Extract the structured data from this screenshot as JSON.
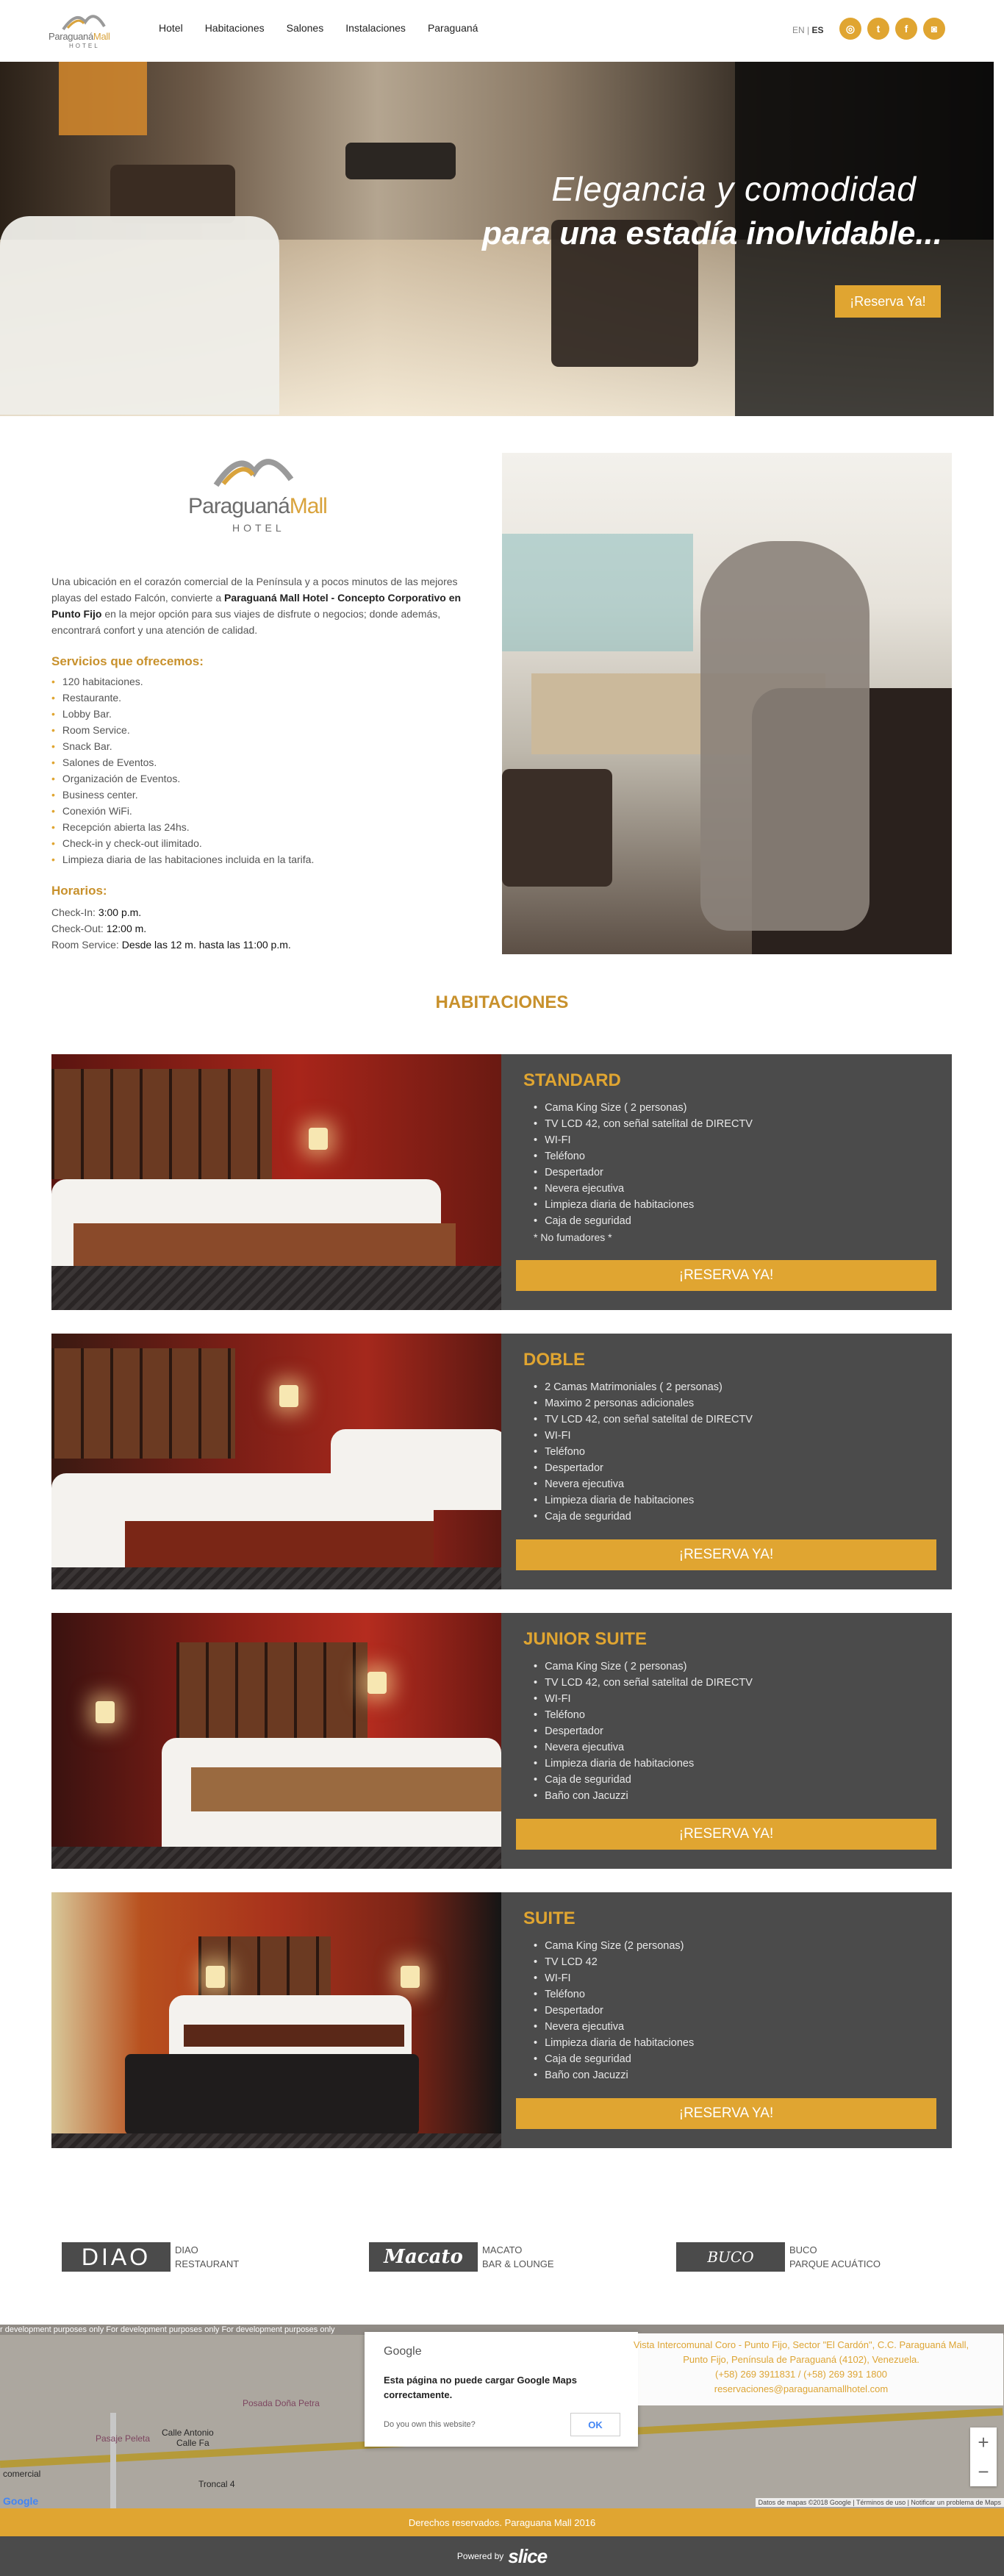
{
  "header": {
    "logo_text_a": "Paraguaná",
    "logo_text_b": "Mall",
    "logo_sub": "HOTEL",
    "nav": [
      "Hotel",
      "Habitaciones",
      "Salones",
      "Instalaciones",
      "Paraguaná"
    ],
    "lang_en": "EN",
    "lang_sep": "|",
    "lang_es": "ES",
    "socials": [
      {
        "icon": "tripadvisor-icon",
        "glyph": "◎"
      },
      {
        "icon": "twitter-icon",
        "glyph": "t"
      },
      {
        "icon": "facebook-icon",
        "glyph": "f"
      },
      {
        "icon": "instagram-icon",
        "glyph": "◙"
      }
    ]
  },
  "hero": {
    "line1": "Elegancia y comodidad",
    "line2": "para una estadía inolvidable...",
    "button": "¡Reserva Ya!"
  },
  "about": {
    "logo_name_a": "Paraguaná",
    "logo_name_b": "Mall",
    "logo_hotel": "HOTEL",
    "intro_1": "Una ubicación en el corazón comercial de la Península y a pocos minutos de las mejores playas del estado Falcón, convierte a ",
    "intro_bold": "Paraguaná Mall Hotel - Concepto Corporativo en Punto Fijo",
    "intro_2": " en la mejor opción para sus viajes de disfrute o negocios; donde además, encontrará confort y una atención de calidad.",
    "services_title": "Servicios que ofrecemos:",
    "services": [
      "120 habitaciones.",
      "Restaurante.",
      "Lobby Bar.",
      "Room Service.",
      "Snack Bar.",
      "Salones de Eventos.",
      "Organización de Eventos.",
      "Business center.",
      "Conexión WiFi.",
      "Recepción abierta las 24hs.",
      "Check-in y check-out ilimitado.",
      "Limpieza diaria de las habitaciones incluida en la tarifa."
    ],
    "hours_title": "Horarios:",
    "hours": [
      {
        "label": "Check-In: ",
        "value": "3:00 p.m."
      },
      {
        "label": "Check-Out: ",
        "value": "12:00 m."
      },
      {
        "label": "Room Service: ",
        "value": "Desde las 12 m. hasta las 11:00 p.m."
      }
    ]
  },
  "rooms_title": "HABITACIONES",
  "rooms": [
    {
      "title": "STANDARD",
      "features": [
        "Cama King Size ( 2 personas)",
        "TV LCD 42, con señal satelital de DIRECTV",
        "WI-FI",
        "Teléfono",
        "Despertador",
        "Nevera ejecutiva",
        "Limpieza diaria de habitaciones",
        "Caja de seguridad"
      ],
      "note": "* No fumadores *",
      "button": "¡RESERVA YA!"
    },
    {
      "title": "DOBLE",
      "features": [
        "2 Camas Matrimoniales ( 2 personas)",
        "Maximo 2 personas adicionales",
        "TV LCD 42, con señal satelital de DIRECTV",
        "WI-FI",
        "Teléfono",
        "Despertador",
        "Nevera ejecutiva",
        "Limpieza diaria de habitaciones",
        "Caja de seguridad"
      ],
      "note": "",
      "button": "¡RESERVA YA!"
    },
    {
      "title": "JUNIOR SUITE",
      "features": [
        "Cama King Size ( 2 personas)",
        "TV LCD 42, con señal satelital de DIRECTV",
        "WI-FI",
        "Teléfono",
        "Despertador",
        "Nevera ejecutiva",
        "Limpieza diaria de habitaciones",
        "Caja de seguridad",
        "Baño con Jacuzzi"
      ],
      "note": "",
      "button": "¡RESERVA YA!"
    },
    {
      "title": "SUITE",
      "features": [
        "Cama King Size (2 personas)",
        "TV LCD 42",
        "WI-FI",
        "Teléfono",
        "Despertador",
        "Nevera ejecutiva",
        "Limpieza diaria de habitaciones",
        "Caja de seguridad",
        "Baño con Jacuzzi"
      ],
      "note": "",
      "button": "¡RESERVA YA!"
    }
  ],
  "partners": [
    {
      "logo": "DIAO",
      "line1": "DIAO",
      "line2": "RESTAURANT"
    },
    {
      "logo": "Macato",
      "line1": "MACATO",
      "line2": "BAR & LOUNGE"
    },
    {
      "logo": "BUCO",
      "line1": "BUCO",
      "line2": "PARQUE ACUÁTICO"
    }
  ],
  "map": {
    "dev_text": "r development purposes only      For development purposes only      For development purposes only",
    "label_posada": "Posada Doña Petra",
    "label_calle": "Calle Antonio",
    "label_calle2": "Calle Fa",
    "label_pasaje": "Pasaje Peleta",
    "label_comercial": "comercial",
    "label_troncal": "Troncal 4",
    "modal_google": "Google",
    "modal_msg": "Esta página no puede cargar Google Maps correctamente.",
    "modal_own": "Do you own this website?",
    "modal_ok": "OK",
    "address_1": "Vista Intercomunal Coro - Punto Fijo, Sector \"El Cardón\", C.C. Paraguaná Mall,",
    "address_2": "Punto Fijo, Península de Paraguaná (4102), Venezuela.",
    "phones": "(+58) 269 3911831 / (+58) 269 391 1800",
    "email": "reservaciones@paraguanamallhotel.com",
    "zoom_in": "+",
    "zoom_out": "−",
    "google_logo": "Google",
    "terms": "Datos de mapas ©2018 Google  |  Términos de uso  |  Notificar un problema de Maps"
  },
  "footer": {
    "rights": "Derechos reservados. Paraguana Mall 2016",
    "powered": "Powered by",
    "slice": "slice"
  }
}
